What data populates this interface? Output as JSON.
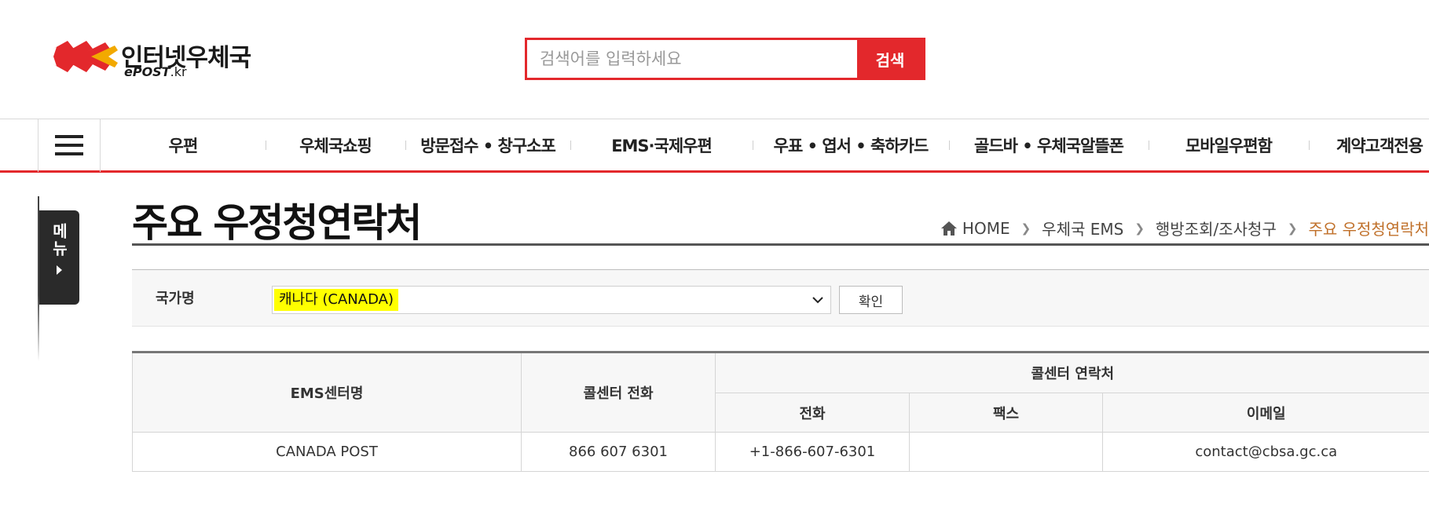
{
  "header": {
    "logo_title": "인터넷우체국",
    "logo_sub_bold": "ePOST",
    "logo_sub_rest": ".kr",
    "search_placeholder": "검색어를 입력하세요",
    "search_button": "검색"
  },
  "gnb": {
    "items": [
      "우편",
      "우체국쇼핑",
      "방문접수 • 창구소포",
      "EMS·국제우편",
      "우표 • 엽서 • 축하카드",
      "골드바 • 우체국알뜰폰",
      "모바일우편함",
      "계약고객전용"
    ]
  },
  "side_menu": {
    "label": "메뉴"
  },
  "page": {
    "title": "주요 우정청연락처",
    "breadcrumb": [
      "HOME",
      "우체국 EMS",
      "행방조회/조사청구",
      "주요 우정청연락처"
    ]
  },
  "form": {
    "country_label": "국가명",
    "selected_country": "캐나다 (CANADA)",
    "confirm_button": "확인"
  },
  "table": {
    "headers": {
      "center_name": "EMS센터명",
      "callcenter_phone": "콜센터 전화",
      "callcenter_contact": "콜센터 연락처",
      "phone": "전화",
      "fax": "팩스",
      "email": "이메일"
    },
    "rows": [
      {
        "center_name": "CANADA POST",
        "callcenter_phone": "866 607 6301",
        "phone": "+1-866-607-6301",
        "fax": "",
        "email": "contact@cbsa.gc.ca"
      }
    ]
  },
  "colors": {
    "brand_red": "#e3282c",
    "highlight": "#ffff00",
    "breadcrumb_current": "#c0702a"
  }
}
